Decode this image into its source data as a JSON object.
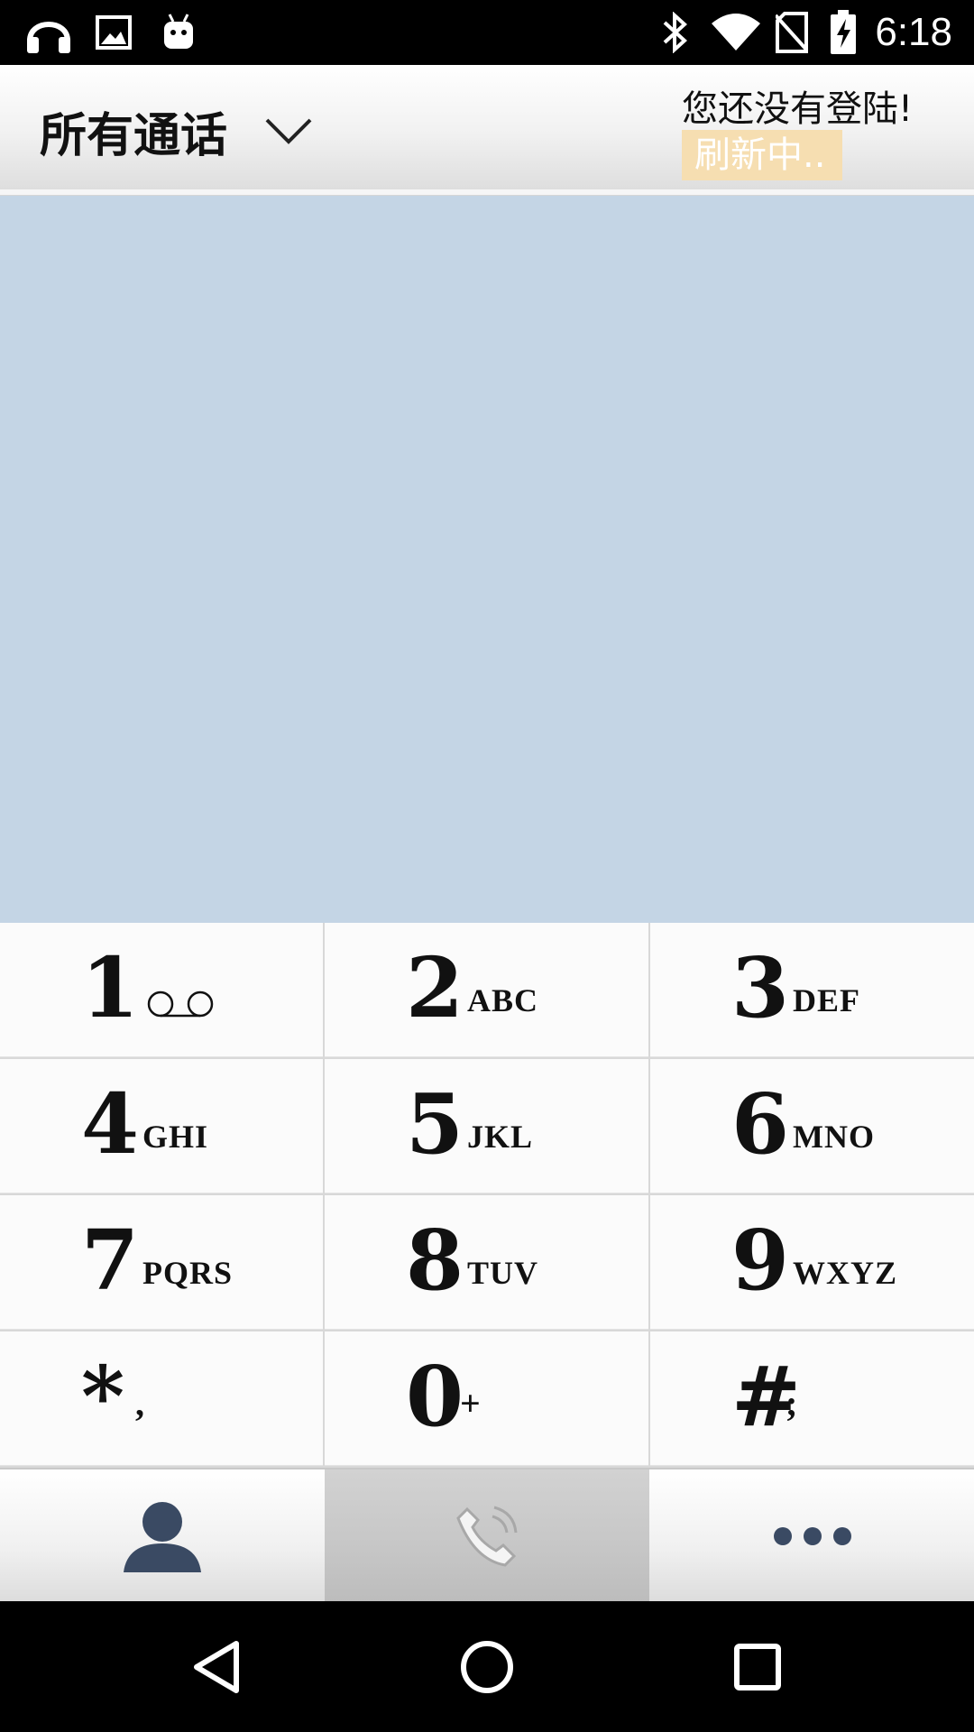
{
  "status_bar": {
    "time": "6:18",
    "left_icons": [
      "headphones-icon",
      "image-icon",
      "android-icon"
    ],
    "right_icons": [
      "bluetooth-icon",
      "wifi-icon",
      "no-sim-icon",
      "battery-charging-icon"
    ]
  },
  "header": {
    "filter_title": "所有通话",
    "login_note": "您还没有登陆!",
    "refresh_label": "刷新中.."
  },
  "keypad": {
    "keys": [
      {
        "digit": "1",
        "letters": ""
      },
      {
        "digit": "2",
        "letters": "ABC"
      },
      {
        "digit": "3",
        "letters": "DEF"
      },
      {
        "digit": "4",
        "letters": "GHI"
      },
      {
        "digit": "5",
        "letters": "JKL"
      },
      {
        "digit": "6",
        "letters": "MNO"
      },
      {
        "digit": "7",
        "letters": "PQRS"
      },
      {
        "digit": "8",
        "letters": "TUV"
      },
      {
        "digit": "9",
        "letters": "WXYZ"
      },
      {
        "digit": "*",
        "letters": ","
      },
      {
        "digit": "0",
        "letters": "+"
      },
      {
        "digit": "#",
        "letters": ";"
      }
    ]
  },
  "tabbar": {
    "tabs": [
      "contacts-icon",
      "phone-icon",
      "more-icon"
    ],
    "active_tab": "phone-icon"
  },
  "colors": {
    "call_list_bg": "#c4d5e5",
    "refresh_badge_bg": "#f6deb1",
    "contacts_icon": "#3a4a63"
  }
}
